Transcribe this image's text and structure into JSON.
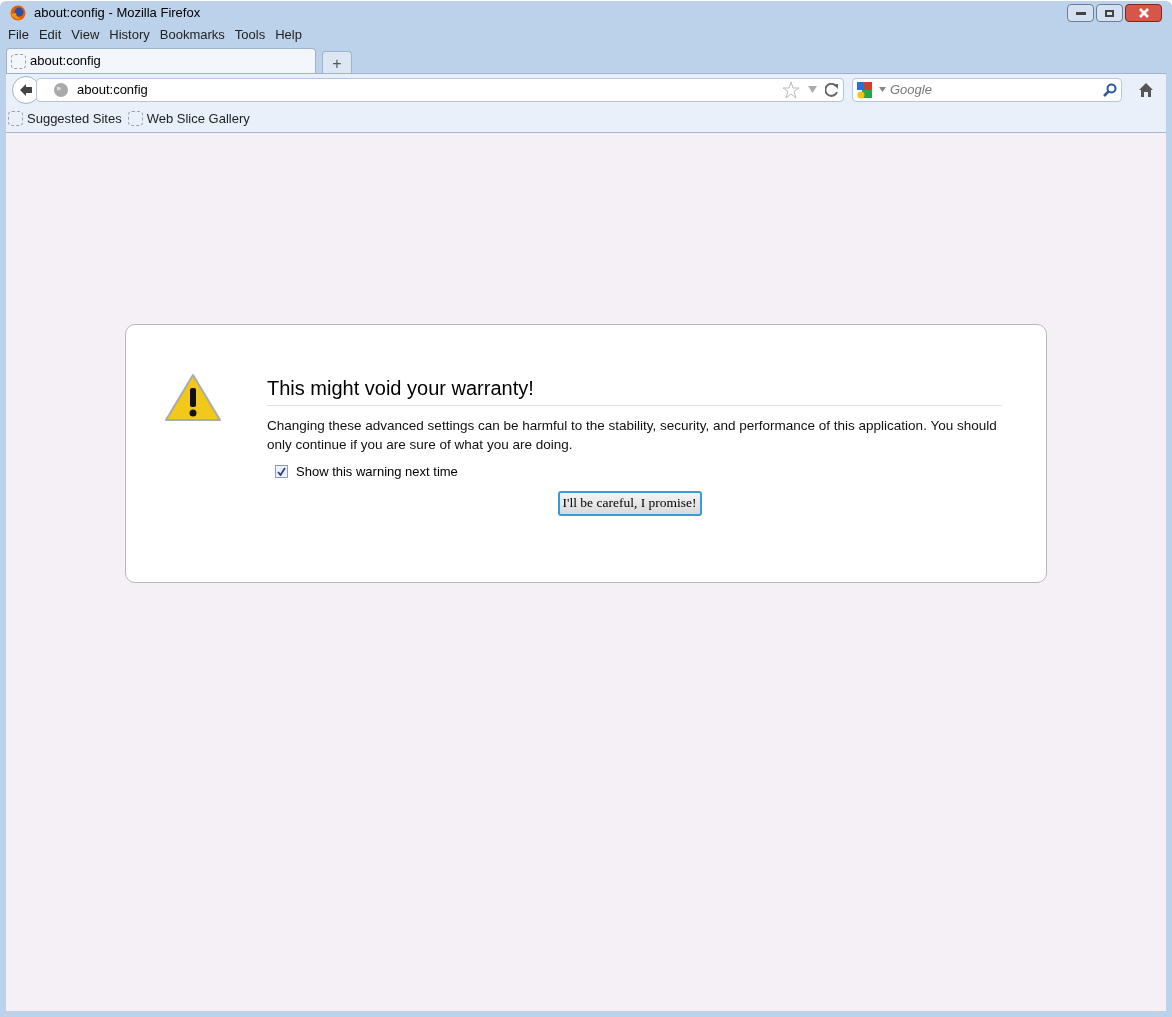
{
  "window": {
    "title": "about:config - Mozilla Firefox"
  },
  "menu": [
    "File",
    "Edit",
    "View",
    "History",
    "Bookmarks",
    "Tools",
    "Help"
  ],
  "tabs": [
    {
      "label": "about:config",
      "selected": true
    }
  ],
  "new_tab": "+",
  "address": {
    "value": "about:config"
  },
  "search": {
    "placeholder": "Google"
  },
  "bookmarks": [
    "Suggested Sites",
    "Web Slice Gallery"
  ],
  "warning": {
    "title": "This might void your warranty!",
    "message": "Changing these advanced settings can be harmful to the stability, security, and performance of this application. You should only continue if you are sure of what you are doing.",
    "checkbox": {
      "label": "Show this warning next time",
      "checked": true
    },
    "button": "I'll be careful, I promise!"
  }
}
